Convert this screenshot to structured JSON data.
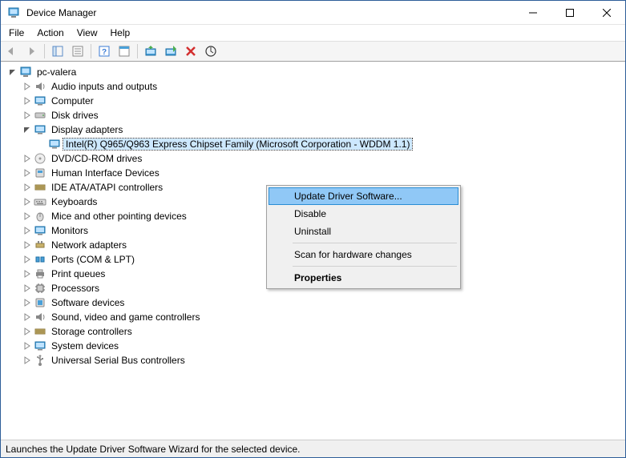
{
  "window": {
    "title": "Device Manager"
  },
  "menubar": [
    "File",
    "Action",
    "View",
    "Help"
  ],
  "tree": {
    "root": "pc-valera",
    "nodes": [
      "Audio inputs and outputs",
      "Computer",
      "Disk drives",
      "Display adapters",
      "DVD/CD-ROM drives",
      "Human Interface Devices",
      "IDE ATA/ATAPI controllers",
      "Keyboards",
      "Mice and other pointing devices",
      "Monitors",
      "Network adapters",
      "Ports (COM & LPT)",
      "Print queues",
      "Processors",
      "Software devices",
      "Sound, video and game controllers",
      "Storage controllers",
      "System devices",
      "Universal Serial Bus controllers"
    ],
    "display_adapters_child": "Intel(R)  Q965/Q963 Express Chipset Family (Microsoft Corporation - WDDM 1.1)"
  },
  "context_menu": {
    "update": "Update Driver Software...",
    "disable": "Disable",
    "uninstall": "Uninstall",
    "scan": "Scan for hardware changes",
    "properties": "Properties"
  },
  "status": "Launches the Update Driver Software Wizard for the selected device."
}
